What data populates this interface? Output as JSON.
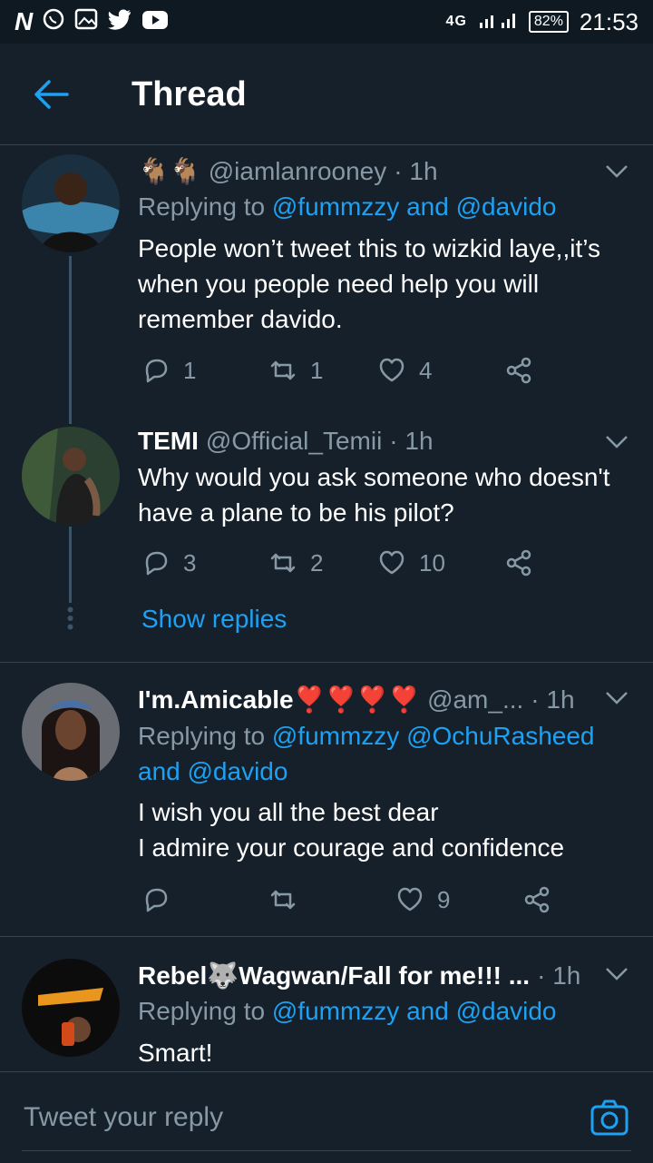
{
  "status_bar": {
    "network": "4G",
    "battery": "82%",
    "time": "21:53",
    "left_icons": [
      "notification-n-icon",
      "whatsapp-icon",
      "gallery-icon",
      "twitter-icon",
      "youtube-icon"
    ]
  },
  "header": {
    "title": "Thread"
  },
  "tweets": [
    {
      "name": "🐐🐐",
      "handle": "@iamlanrooney",
      "time": "· 1h",
      "replying_prefix": "Replying to",
      "replying_mentions": "@fummzzy and @davido",
      "text": "People won’t tweet this to wizkid laye,,it’s when you people need help you will remember davido.",
      "replies": "1",
      "retweets": "1",
      "likes": "4"
    },
    {
      "name": "TEMI",
      "handle": "@Official_Temii",
      "time": "· 1h",
      "text": "Why would you ask someone who doesn't have a plane to be his pilot?",
      "replies": "3",
      "retweets": "2",
      "likes": "10",
      "show_replies": "Show replies"
    },
    {
      "name": "I'm.Amicable❣️❣️❣️❣️",
      "handle": "@am_...",
      "time": "· 1h",
      "replying_prefix": "Replying to",
      "replying_mentions": "@fummzzy @OchuRasheed and @davido",
      "text": "I wish you all the best dear\nI admire your courage and confidence",
      "replies": "",
      "retweets": "",
      "likes": "9"
    },
    {
      "name": "Rebel🐺Wagwan/Fall for me!!! ...",
      "handle": "",
      "time": "· 1h",
      "replying_prefix": "Replying to",
      "replying_mentions": "@fummzzy and @davido",
      "text": "Smart!"
    }
  ],
  "reply_box": {
    "placeholder": "Tweet your reply"
  },
  "colors": {
    "background": "#15202b",
    "accent": "#1da1f2",
    "muted": "#8899a6",
    "divider": "#38444d"
  }
}
